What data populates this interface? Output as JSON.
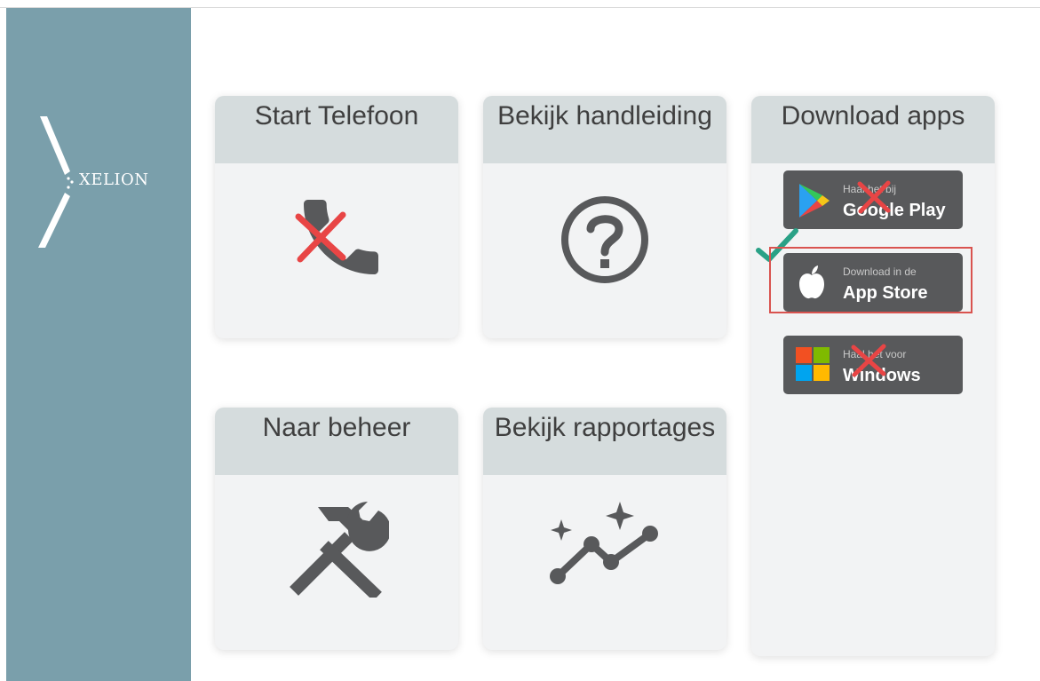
{
  "brand": {
    "name": "XELION",
    "background": "#7a9fab"
  },
  "tiles": [
    {
      "title": "Start Telefoon",
      "icon": "phone-icon"
    },
    {
      "title": "Bekijk handleiding",
      "icon": "help-circle-icon"
    },
    {
      "title": "Naar beheer",
      "icon": "tools-icon"
    },
    {
      "title": "Bekijk rapportages",
      "icon": "analytics-icon"
    }
  ],
  "downloads": {
    "title": "Download apps",
    "google": {
      "small": "Haal het bij",
      "big": "Google Play",
      "icon": "google-play-icon"
    },
    "apple": {
      "small": "Download in de",
      "big": "App Store",
      "icon": "apple-icon"
    },
    "windows": {
      "small": "Haal het voor",
      "big": "Windows",
      "icon": "windows-icon"
    }
  },
  "annotations": {
    "cross_color": "#e84545",
    "check_color": "#2aa186",
    "highlight_color": "#d9534f"
  }
}
